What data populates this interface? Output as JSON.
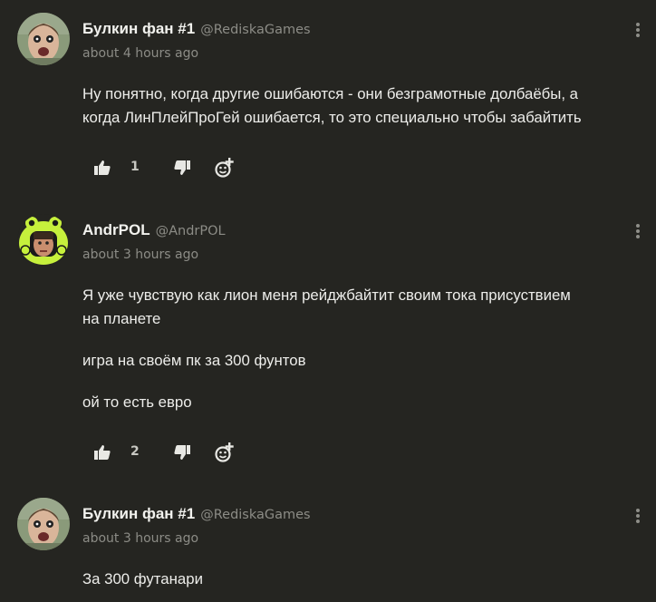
{
  "comments": [
    {
      "author": "Булкин фан #1",
      "handle": "@RediskaGames",
      "time": "about 4 hours ago",
      "paragraphs": [
        "Ну понятно, когда другие ошибаются - они безграмотные долбаёбы, а",
        "когда ЛинПлейПроГей ошибается, то это специально чтобы забайтить"
      ],
      "likes": "1",
      "avatar_icon": "face-avatar-icon"
    },
    {
      "author": "AndrPOL",
      "handle": "@AndrPOL",
      "time": "about 3 hours ago",
      "paragraphs": [
        "Я уже чувствую как лион меня рейджбайтит своим тока присуствием",
        "на планете"
      ],
      "paragraphs2": [
        "игра на своём пк за 300 фунтов"
      ],
      "paragraphs3": [
        "ой то есть евро"
      ],
      "likes": "2",
      "avatar_icon": "frog-avatar-icon"
    },
    {
      "author": "Булкин фан #1",
      "handle": "@RediskaGames",
      "time": "about 3 hours ago",
      "paragraphs": [
        "За 300 футанари"
      ],
      "avatar_icon": "face-avatar-icon"
    }
  ],
  "colors": {
    "background": "#252521",
    "text": "#ededea",
    "muted": "#8c8c86",
    "frog_green": "#c6f03c"
  },
  "icons": {
    "like": "thumbs-up-icon",
    "dislike": "thumbs-down-icon",
    "reply": "add-reaction-icon",
    "more": "more-vertical-icon"
  }
}
